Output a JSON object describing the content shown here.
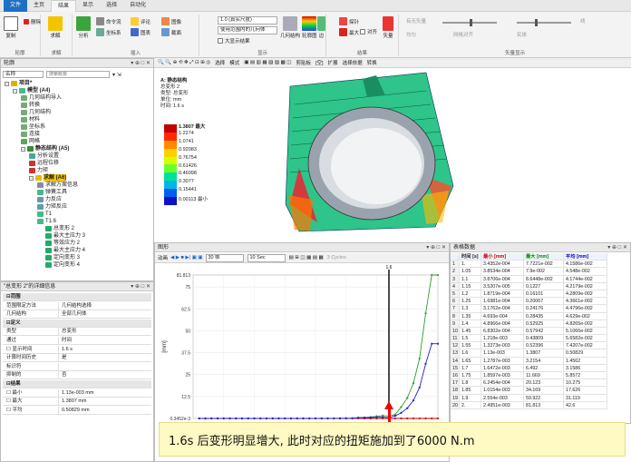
{
  "ribbon": {
    "tabs": [
      "文件",
      "主页",
      "结果",
      "显示",
      "选择",
      "自动化"
    ],
    "groups": {
      "outline": {
        "label": "轮廓",
        "copy": "复制",
        "delete": "删除"
      },
      "solve": {
        "label": "求解",
        "solve": "求解"
      },
      "insert": {
        "label": "插入",
        "analysis": "分析",
        "items": [
          "命令流",
          "注释",
          "坐标系",
          "截面",
          "评论",
          "图表",
          "图像",
          "注释"
        ]
      },
      "display": {
        "label": "显示",
        "scale_combo": "1.0 (真实尺度)",
        "geom_combo": "使用范围内的几何体",
        "checkbox_max": "大显示结果",
        "geometry_btn": "几何结构",
        "contour_btn": "轮廓图",
        "edge_btn": "边"
      },
      "result": {
        "label": "结果",
        "probe": "探针",
        "max": "最大",
        "min": "最小",
        "label_btn": "对齐",
        "extremum": "矢量"
      },
      "vector": {
        "label": "矢量显示",
        "items": [
          "有无矢量",
          "均匀",
          "实体",
          "线",
          "网格对齐"
        ]
      }
    }
  },
  "outline": {
    "title": "轮廓",
    "name_label": "名称",
    "search_placeholder": "搜索概要",
    "tree": [
      {
        "label": "项目*",
        "level": 0,
        "kind": "project"
      },
      {
        "label": "模型 (A4)",
        "level": 1,
        "kind": "model"
      },
      {
        "label": "几何结构导入",
        "level": 2,
        "kind": "geom"
      },
      {
        "label": "转换",
        "level": 2,
        "kind": "geom"
      },
      {
        "label": "几何结构",
        "level": 2,
        "kind": "geom"
      },
      {
        "label": "材料",
        "level": 2,
        "kind": "geom"
      },
      {
        "label": "坐标系",
        "level": 2,
        "kind": "geom"
      },
      {
        "label": "连接",
        "level": 2,
        "kind": "geom"
      },
      {
        "label": "网格",
        "level": 2,
        "kind": "mesh"
      },
      {
        "label": "静态结构 (A5)",
        "level": 2,
        "kind": "analysis"
      },
      {
        "label": "分析设置",
        "level": 3,
        "kind": "setting"
      },
      {
        "label": "远程位移",
        "level": 3,
        "kind": "bc"
      },
      {
        "label": "力矩",
        "level": 3,
        "kind": "bc"
      },
      {
        "label": "求解 (A6)",
        "level": 3,
        "kind": "solution",
        "selected": true
      },
      {
        "label": "求解方案信息",
        "level": 4,
        "kind": "info"
      },
      {
        "label": "弹簧工具",
        "level": 4,
        "kind": "tool"
      },
      {
        "label": "力反应",
        "level": 4,
        "kind": "react"
      },
      {
        "label": "力矩反应",
        "level": 4,
        "kind": "react"
      },
      {
        "label": "T1",
        "level": 4,
        "kind": "tool"
      },
      {
        "label": "T1.6",
        "level": 4,
        "kind": "tool"
      },
      {
        "label": "总变形 2",
        "level": 5,
        "kind": "result"
      },
      {
        "label": "最大主应力 3",
        "level": 5,
        "kind": "result"
      },
      {
        "label": "等效应力 2",
        "level": 5,
        "kind": "result"
      },
      {
        "label": "最大主应力 4",
        "level": 5,
        "kind": "result"
      },
      {
        "label": "定向变形 3",
        "level": 5,
        "kind": "result"
      },
      {
        "label": "定向变形 4",
        "level": 5,
        "kind": "result"
      }
    ]
  },
  "details": {
    "title": "\"总变形 2\"的详细信息",
    "rows": [
      {
        "type": "section",
        "label": "范围"
      },
      {
        "label": "范围限定方法",
        "value": "几何结构选择"
      },
      {
        "label": "几何结构",
        "value": "全部几何体"
      },
      {
        "type": "section",
        "label": "定义"
      },
      {
        "label": "类型",
        "value": "总变形"
      },
      {
        "label": "通过",
        "value": "时间"
      },
      {
        "label": "显示时间",
        "value": "1.6 s",
        "check": true
      },
      {
        "label": "计算时间历史",
        "value": "是"
      },
      {
        "label": "标识符",
        "value": ""
      },
      {
        "label": "抑制的",
        "value": "否"
      },
      {
        "type": "section",
        "label": "结果"
      },
      {
        "label": "最小",
        "value": "1.13e-003 mm",
        "check": true
      },
      {
        "label": "最大",
        "value": "1.3807 mm",
        "check": true
      },
      {
        "label": "平均",
        "value": "0.50829 mm",
        "check": true
      }
    ]
  },
  "viewer": {
    "toolbar": [
      "选择",
      "模式",
      "剪贴板",
      "[空]",
      "扩展",
      "选择依据",
      "转换"
    ],
    "info": {
      "line1": "A: 静态结构",
      "line2": "总变形 2",
      "line3": "类型: 总变形",
      "line4": "单位: mm",
      "line5": "时间: 1.6 s"
    },
    "legend": [
      "1.3807 最大",
      "1.2274",
      "1.0741",
      "0.92083",
      "0.76754",
      "0.61426",
      "0.46098",
      "0.3077",
      "0.15441",
      "0.00113 最小"
    ],
    "legend_colors": [
      "#c20000",
      "#ff2a00",
      "#ff8a00",
      "#ffd000",
      "#d4ff00",
      "#6bff2e",
      "#00e19a",
      "#00b7e6",
      "#005ff0",
      "#1010c8"
    ]
  },
  "graph": {
    "title": "图形",
    "anim_label": "动画",
    "frames_combo": "30 帧",
    "time_combo": "10 Sec",
    "cycles": "3 Cycles",
    "marker_label": "1.6",
    "x_unit": "[s]",
    "y_unit": "[mm]",
    "bottom_labels": [
      "1",
      "2"
    ]
  },
  "chart_data": {
    "type": "line",
    "xlabel": "[s]",
    "ylabel": "[mm]",
    "xlim": [
      0,
      2
    ],
    "ylim": [
      0,
      81.813
    ],
    "x_ticks": [
      "0",
      "0.25",
      "0.5",
      "0.75",
      "1",
      "1.25",
      "1.5",
      "1.75",
      "2"
    ],
    "y_ticks": [
      "0.3452e-3",
      "12.5",
      "25",
      "37.5",
      "50",
      "62.5",
      "75",
      "81.813"
    ],
    "x": [
      0.05,
      0.1,
      0.15,
      0.2,
      0.25,
      0.3,
      0.35,
      0.4,
      0.45,
      0.5,
      0.55,
      0.6,
      0.65,
      0.7,
      0.75,
      0.8,
      0.85,
      0.9,
      0.95,
      1.0,
      1.05,
      1.1,
      1.15,
      1.2,
      1.25,
      1.3,
      1.35,
      1.4,
      1.45,
      1.5,
      1.55,
      1.6,
      1.65,
      1.7,
      1.75,
      1.8,
      1.85,
      1.9,
      1.95,
      2.0
    ],
    "series": [
      {
        "name": "最小",
        "color": "#d00000",
        "values": [
          0,
          0,
          0,
          0,
          0,
          0,
          0,
          0,
          0,
          0,
          0,
          0,
          0,
          0,
          0,
          0,
          0,
          0,
          0,
          0,
          0,
          0,
          0,
          0,
          0,
          0,
          0,
          0,
          0,
          0,
          0,
          0,
          0,
          0,
          0,
          0,
          0,
          0,
          0,
          0.001
        ]
      },
      {
        "name": "最大",
        "color": "#2aa02a",
        "values": [
          0,
          0,
          0,
          0,
          0,
          0,
          0,
          0,
          0,
          0,
          0,
          0,
          0,
          0,
          0,
          0,
          0,
          0,
          0,
          0.0026,
          0.0079,
          0.0123,
          0.0286,
          0.0591,
          0.1062,
          0.1681,
          0.2841,
          0.5293,
          0.7794,
          1.2151,
          1.6011,
          1.3807,
          2.1514,
          6.492,
          11.669,
          20.123,
          34.169,
          59.922,
          81.813,
          81.813
        ]
      },
      {
        "name": "平均",
        "color": "#2020d0",
        "values": [
          0,
          0,
          0,
          0,
          0,
          0,
          0,
          0,
          0,
          0,
          0,
          0,
          0,
          0,
          0,
          0,
          0,
          0,
          0,
          0.0014,
          0.0042,
          0.0219,
          0.0429,
          0.0366,
          0.0478,
          0.1082,
          0.4629,
          0.4826,
          0.5007,
          0.6582,
          0.742,
          0.5083,
          1.4562,
          3.1586,
          5.8572,
          10.275,
          17.626,
          31.119,
          42.6,
          42.6
        ]
      }
    ]
  },
  "table": {
    "title": "表格数据",
    "headers": [
      "",
      "时间 [s]",
      "最小 [mm]",
      "最大 [mm]",
      "平均 [mm]"
    ],
    "rows": [
      [
        "1",
        "1.",
        "3.4352e-004",
        "7.7221e-002",
        "4.1586e-002"
      ],
      [
        "2",
        "1.05",
        "3.8534e-004",
        "7.9e-002",
        "4.548e-002"
      ],
      [
        "3",
        "1.1",
        "3.8706e-004",
        "8.6448e-002",
        "4.1744e-002"
      ],
      [
        "4",
        "1.15",
        "3.5207e-005",
        "0.1227",
        "4.2179e-002"
      ],
      [
        "5",
        "1.2",
        "1.8719e-004",
        "0.16101",
        "4.2809e-002"
      ],
      [
        "6",
        "1.25",
        "1.6981e-004",
        "0.20067",
        "4.3661e-002"
      ],
      [
        "7",
        "1.3",
        "3.1762e-004",
        "0.24176",
        "4.4796e-002"
      ],
      [
        "8",
        "1.35",
        "4.693e-004",
        "0.28435",
        "4.629e-002"
      ],
      [
        "9",
        "1.4",
        "4.8966e-004",
        "0.52925",
        "4.8265e-002"
      ],
      [
        "10",
        "1.45",
        "6.8302e-004",
        "0.57942",
        "5.1066e-002"
      ],
      [
        "11",
        "1.5",
        "1.218e-003",
        "0.43809",
        "5.6582e-002"
      ],
      [
        "12",
        "1.55",
        "1.3373e-003",
        "0.52396",
        "7.4207e-002"
      ],
      [
        "13",
        "1.6",
        "1.13e-003",
        "1.3807",
        "0.50829"
      ],
      [
        "14",
        "1.65",
        "1.2787e-003",
        "3.2154",
        "1.4562"
      ],
      [
        "15",
        "1.7",
        "1.6472e-003",
        "6.492",
        "3.1586"
      ],
      [
        "16",
        "1.75",
        "1.8597e-003",
        "11.669",
        "5.8572"
      ],
      [
        "17",
        "1.8",
        "6.2454e-004",
        "20.123",
        "10.275"
      ],
      [
        "18",
        "1.85",
        "1.0154e-003",
        "34.169",
        "17.626"
      ],
      [
        "19",
        "1.9",
        "2.554e-003",
        "59.922",
        "31.119"
      ],
      [
        "20",
        "2.",
        "2.4951e-003",
        "81.813",
        "42.6"
      ]
    ]
  },
  "caption": "1.6s 后变形明显增大, 此时对应的扭矩施加到了6000 N.m"
}
